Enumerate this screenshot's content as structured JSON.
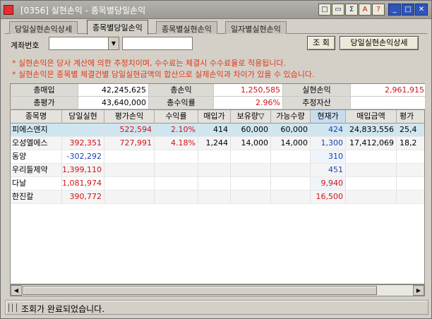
{
  "window": {
    "title": "[0356] 실현손익 - 종목별당일손익",
    "title_buttons": [
      "□",
      "▭",
      "Σ",
      "A",
      "?"
    ],
    "controls": [
      "_",
      "□",
      "✕"
    ]
  },
  "tabs": [
    {
      "label": "당일실현손익상세",
      "active": false
    },
    {
      "label": "종목별당일손익",
      "active": true
    },
    {
      "label": "종목별실현손익",
      "active": false
    },
    {
      "label": "일자별실현손익",
      "active": false
    }
  ],
  "account": {
    "label": "계좌번호",
    "number_value": "",
    "name_value": ""
  },
  "buttons": {
    "query": "조 회",
    "detail": "당일실현손익상세"
  },
  "notes": [
    "* 실현손익은 당사 계산에 의한 추정치이며, 수수료는 체결시 수수료율로 적용됩니다.",
    "* 실현손익은 종목별 체결건별 당일실현금액의 합산으로 실제손익과 차이가 있을 수 있습니다."
  ],
  "summary": {
    "total_buy_label": "총매입",
    "total_buy": "42,245,625",
    "total_pl_label": "총손익",
    "total_pl": "1,250,585",
    "realized_pl_label": "실현손익",
    "realized_pl": "2,961,915",
    "total_eval_label": "총평가",
    "total_eval": "43,640,000",
    "total_rate_label": "총수익률",
    "total_rate": "2.96%",
    "est_asset_label": "추정자산",
    "est_asset": ""
  },
  "table": {
    "headers": [
      "종목명",
      "당일실현",
      "평가손익",
      "수익률",
      "매입가",
      "보유량",
      "가능수량",
      "현재가",
      "매입금액",
      "평가"
    ],
    "sort_marker": "▽",
    "rows": [
      [
        "피에스엔지",
        "",
        "522,594",
        "2.10%",
        "414",
        "60,000",
        "60,000",
        "424",
        "24,833,556",
        "25,4"
      ],
      [
        "오성엘에스",
        "392,351",
        "727,991",
        "4.18%",
        "1,244",
        "14,000",
        "14,000",
        "1,300",
        "17,412,069",
        "18,2"
      ],
      [
        "동양",
        "-302,292",
        "",
        "",
        "",
        "",
        "",
        "310",
        "",
        ""
      ],
      [
        "우리들제약",
        "1,399,110",
        "",
        "",
        "",
        "",
        "",
        "451",
        "",
        ""
      ],
      [
        "다날",
        "1,081,974",
        "",
        "",
        "",
        "",
        "",
        "9,940",
        "",
        ""
      ],
      [
        "한진칼",
        "390,772",
        "",
        "",
        "",
        "",
        "",
        "16,500",
        "",
        ""
      ]
    ]
  },
  "status": {
    "message": "조회가 완료되었습니다."
  },
  "colors": {
    "positive": "#d2131a",
    "negative": "#1b3fb6",
    "note": "#e03a1a",
    "selected_row": "#cfe6f0"
  },
  "icons": [
    "app-icon",
    "chevron-down-icon",
    "chevron-left-icon",
    "chevron-right-icon",
    "grip-icon"
  ]
}
